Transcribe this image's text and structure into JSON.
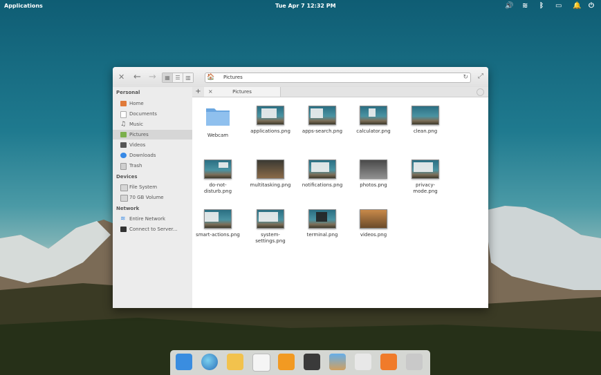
{
  "panel": {
    "applications": "Applications",
    "clock": "Tue Apr  7    12:32 PM",
    "indicators": [
      "volume-icon",
      "wifi-icon",
      "bluetooth-icon",
      "battery-icon",
      "notifications-icon",
      "power-icon"
    ]
  },
  "window": {
    "path": {
      "crumb": "Pictures"
    },
    "sidebar": {
      "sections": [
        {
          "title": "Personal",
          "items": [
            "Home",
            "Documents",
            "Music",
            "Pictures",
            "Videos",
            "Downloads",
            "Trash"
          ]
        },
        {
          "title": "Devices",
          "items": [
            "File System",
            "70 GB Volume"
          ]
        },
        {
          "title": "Network",
          "items": [
            "Entire Network",
            "Connect to Server..."
          ]
        }
      ],
      "selected": "Pictures"
    },
    "tab": {
      "plus": "+",
      "close": "×",
      "title": "Pictures"
    },
    "files": [
      "Webcam",
      "applications.png",
      "apps-search.png",
      "calculator.png",
      "clean.png",
      "do-not-\ndisturb.png",
      "multitasking.png",
      "notifications.png",
      "photos.png",
      "privacy-\nmode.png",
      "smart-actions.png",
      "system-\nsettings.png",
      "terminal.png",
      "videos.png"
    ]
  },
  "dock": {
    "apps": [
      "multitasking-view",
      "web-browser",
      "mail",
      "calendar",
      "music",
      "videos",
      "photos",
      "system-settings",
      "app-center",
      "files"
    ]
  },
  "colors": {
    "accent": "#3689e6",
    "desktop_sky": "#0f5d74"
  }
}
